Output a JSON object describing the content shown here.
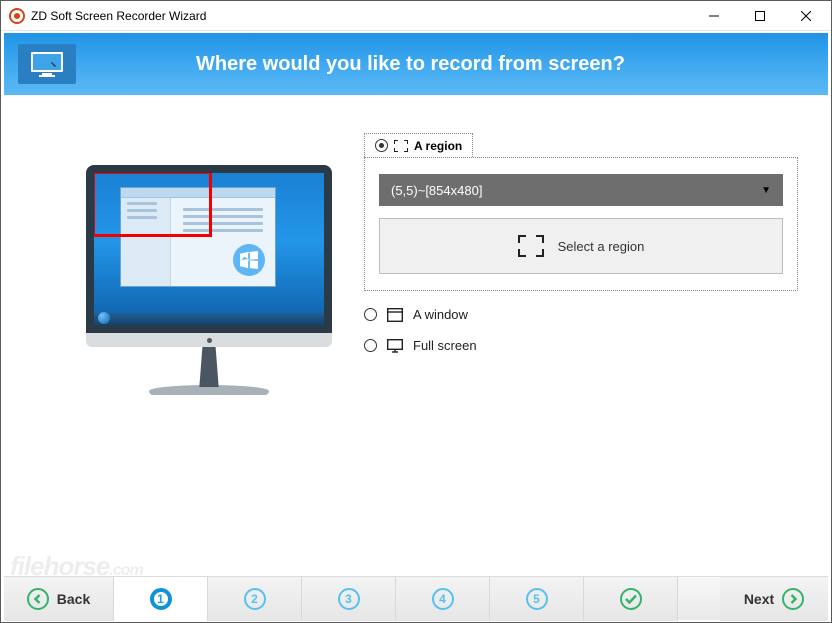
{
  "window": {
    "title": "ZD Soft Screen Recorder Wizard"
  },
  "banner": {
    "title": "Where would you like to record from screen?"
  },
  "options": {
    "region": {
      "label": "A region",
      "selected_value": "(5,5)~[854x480]",
      "button_label": "Select a region"
    },
    "window": {
      "label": "A window"
    },
    "fullscreen": {
      "label": "Full screen"
    }
  },
  "footer": {
    "back": "Back",
    "next": "Next",
    "steps": [
      "1",
      "2",
      "3",
      "4",
      "5"
    ]
  },
  "watermark": "filehorse",
  "watermark_tld": ".com"
}
